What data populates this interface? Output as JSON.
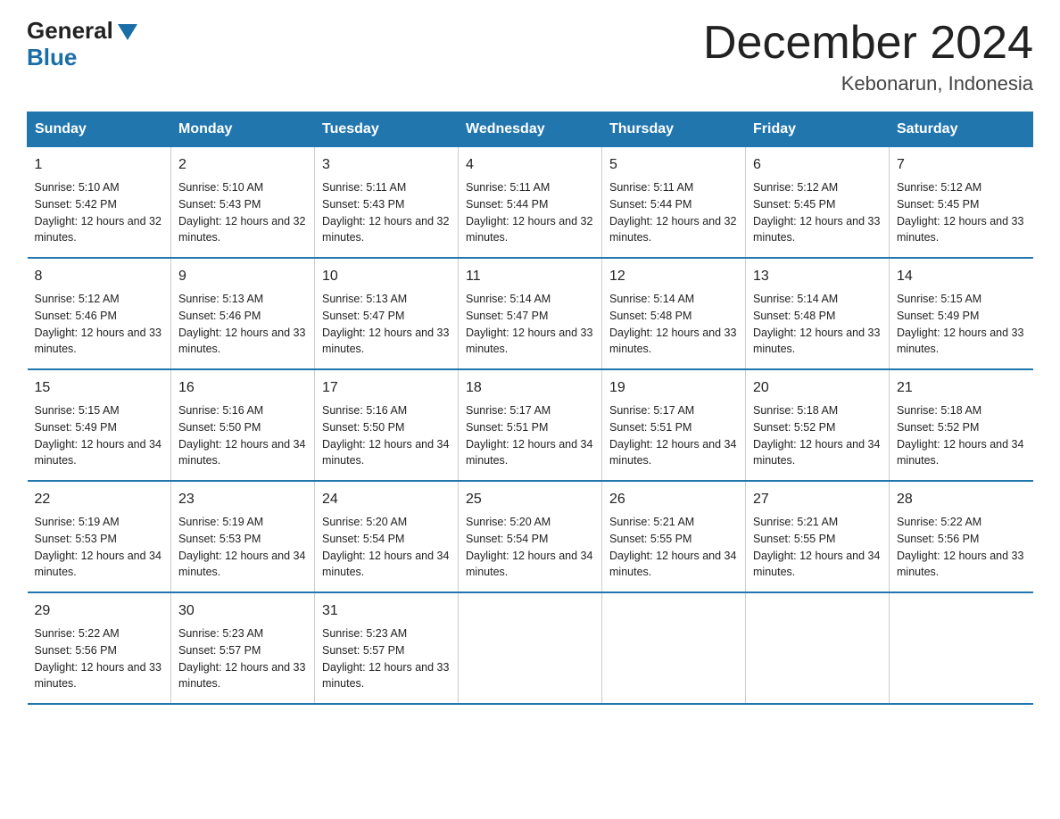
{
  "logo": {
    "general": "General",
    "blue": "Blue"
  },
  "title": "December 2024",
  "location": "Kebonarun, Indonesia",
  "days_of_week": [
    "Sunday",
    "Monday",
    "Tuesday",
    "Wednesday",
    "Thursday",
    "Friday",
    "Saturday"
  ],
  "weeks": [
    [
      {
        "day": "1",
        "sunrise": "Sunrise: 5:10 AM",
        "sunset": "Sunset: 5:42 PM",
        "daylight": "Daylight: 12 hours and 32 minutes."
      },
      {
        "day": "2",
        "sunrise": "Sunrise: 5:10 AM",
        "sunset": "Sunset: 5:43 PM",
        "daylight": "Daylight: 12 hours and 32 minutes."
      },
      {
        "day": "3",
        "sunrise": "Sunrise: 5:11 AM",
        "sunset": "Sunset: 5:43 PM",
        "daylight": "Daylight: 12 hours and 32 minutes."
      },
      {
        "day": "4",
        "sunrise": "Sunrise: 5:11 AM",
        "sunset": "Sunset: 5:44 PM",
        "daylight": "Daylight: 12 hours and 32 minutes."
      },
      {
        "day": "5",
        "sunrise": "Sunrise: 5:11 AM",
        "sunset": "Sunset: 5:44 PM",
        "daylight": "Daylight: 12 hours and 32 minutes."
      },
      {
        "day": "6",
        "sunrise": "Sunrise: 5:12 AM",
        "sunset": "Sunset: 5:45 PM",
        "daylight": "Daylight: 12 hours and 33 minutes."
      },
      {
        "day": "7",
        "sunrise": "Sunrise: 5:12 AM",
        "sunset": "Sunset: 5:45 PM",
        "daylight": "Daylight: 12 hours and 33 minutes."
      }
    ],
    [
      {
        "day": "8",
        "sunrise": "Sunrise: 5:12 AM",
        "sunset": "Sunset: 5:46 PM",
        "daylight": "Daylight: 12 hours and 33 minutes."
      },
      {
        "day": "9",
        "sunrise": "Sunrise: 5:13 AM",
        "sunset": "Sunset: 5:46 PM",
        "daylight": "Daylight: 12 hours and 33 minutes."
      },
      {
        "day": "10",
        "sunrise": "Sunrise: 5:13 AM",
        "sunset": "Sunset: 5:47 PM",
        "daylight": "Daylight: 12 hours and 33 minutes."
      },
      {
        "day": "11",
        "sunrise": "Sunrise: 5:14 AM",
        "sunset": "Sunset: 5:47 PM",
        "daylight": "Daylight: 12 hours and 33 minutes."
      },
      {
        "day": "12",
        "sunrise": "Sunrise: 5:14 AM",
        "sunset": "Sunset: 5:48 PM",
        "daylight": "Daylight: 12 hours and 33 minutes."
      },
      {
        "day": "13",
        "sunrise": "Sunrise: 5:14 AM",
        "sunset": "Sunset: 5:48 PM",
        "daylight": "Daylight: 12 hours and 33 minutes."
      },
      {
        "day": "14",
        "sunrise": "Sunrise: 5:15 AM",
        "sunset": "Sunset: 5:49 PM",
        "daylight": "Daylight: 12 hours and 33 minutes."
      }
    ],
    [
      {
        "day": "15",
        "sunrise": "Sunrise: 5:15 AM",
        "sunset": "Sunset: 5:49 PM",
        "daylight": "Daylight: 12 hours and 34 minutes."
      },
      {
        "day": "16",
        "sunrise": "Sunrise: 5:16 AM",
        "sunset": "Sunset: 5:50 PM",
        "daylight": "Daylight: 12 hours and 34 minutes."
      },
      {
        "day": "17",
        "sunrise": "Sunrise: 5:16 AM",
        "sunset": "Sunset: 5:50 PM",
        "daylight": "Daylight: 12 hours and 34 minutes."
      },
      {
        "day": "18",
        "sunrise": "Sunrise: 5:17 AM",
        "sunset": "Sunset: 5:51 PM",
        "daylight": "Daylight: 12 hours and 34 minutes."
      },
      {
        "day": "19",
        "sunrise": "Sunrise: 5:17 AM",
        "sunset": "Sunset: 5:51 PM",
        "daylight": "Daylight: 12 hours and 34 minutes."
      },
      {
        "day": "20",
        "sunrise": "Sunrise: 5:18 AM",
        "sunset": "Sunset: 5:52 PM",
        "daylight": "Daylight: 12 hours and 34 minutes."
      },
      {
        "day": "21",
        "sunrise": "Sunrise: 5:18 AM",
        "sunset": "Sunset: 5:52 PM",
        "daylight": "Daylight: 12 hours and 34 minutes."
      }
    ],
    [
      {
        "day": "22",
        "sunrise": "Sunrise: 5:19 AM",
        "sunset": "Sunset: 5:53 PM",
        "daylight": "Daylight: 12 hours and 34 minutes."
      },
      {
        "day": "23",
        "sunrise": "Sunrise: 5:19 AM",
        "sunset": "Sunset: 5:53 PM",
        "daylight": "Daylight: 12 hours and 34 minutes."
      },
      {
        "day": "24",
        "sunrise": "Sunrise: 5:20 AM",
        "sunset": "Sunset: 5:54 PM",
        "daylight": "Daylight: 12 hours and 34 minutes."
      },
      {
        "day": "25",
        "sunrise": "Sunrise: 5:20 AM",
        "sunset": "Sunset: 5:54 PM",
        "daylight": "Daylight: 12 hours and 34 minutes."
      },
      {
        "day": "26",
        "sunrise": "Sunrise: 5:21 AM",
        "sunset": "Sunset: 5:55 PM",
        "daylight": "Daylight: 12 hours and 34 minutes."
      },
      {
        "day": "27",
        "sunrise": "Sunrise: 5:21 AM",
        "sunset": "Sunset: 5:55 PM",
        "daylight": "Daylight: 12 hours and 34 minutes."
      },
      {
        "day": "28",
        "sunrise": "Sunrise: 5:22 AM",
        "sunset": "Sunset: 5:56 PM",
        "daylight": "Daylight: 12 hours and 33 minutes."
      }
    ],
    [
      {
        "day": "29",
        "sunrise": "Sunrise: 5:22 AM",
        "sunset": "Sunset: 5:56 PM",
        "daylight": "Daylight: 12 hours and 33 minutes."
      },
      {
        "day": "30",
        "sunrise": "Sunrise: 5:23 AM",
        "sunset": "Sunset: 5:57 PM",
        "daylight": "Daylight: 12 hours and 33 minutes."
      },
      {
        "day": "31",
        "sunrise": "Sunrise: 5:23 AM",
        "sunset": "Sunset: 5:57 PM",
        "daylight": "Daylight: 12 hours and 33 minutes."
      },
      null,
      null,
      null,
      null
    ]
  ]
}
